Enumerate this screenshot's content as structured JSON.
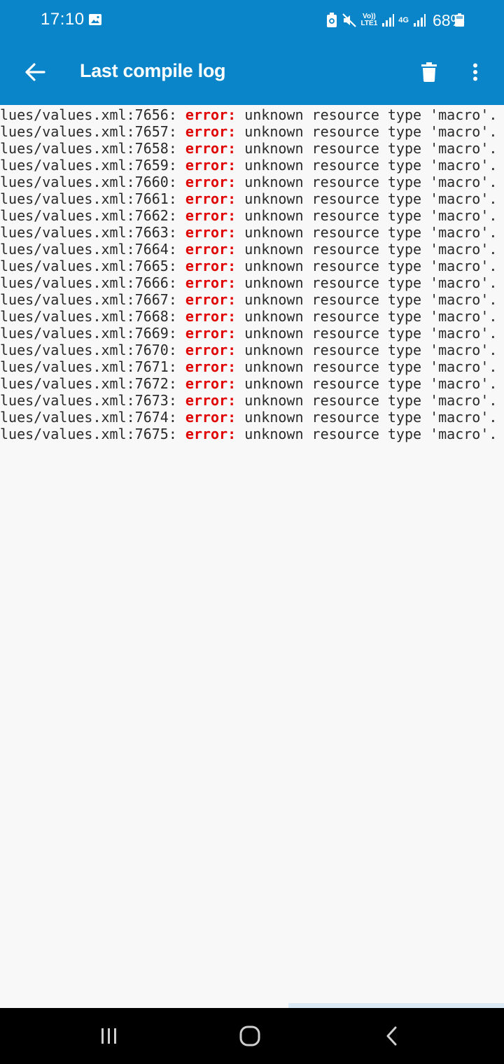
{
  "status_bar": {
    "time": "17:10",
    "network_volte": "Vo))",
    "network_lte": "LTE1",
    "network_4g": "4G",
    "battery_percent": "68%",
    "icons": [
      "gallery-icon",
      "battery-saver-icon",
      "mute-icon",
      "signal-icon",
      "signal-icon",
      "battery-icon"
    ]
  },
  "app_bar": {
    "title": "Last compile log",
    "background_color": "#0a85c9",
    "icons": [
      "back-arrow-icon",
      "trash-icon",
      "more-vert-icon"
    ]
  },
  "log": {
    "error_color": "#e00000",
    "lines": [
      {
        "prefix": "lues/values.xml:7656: ",
        "level": "error:",
        "message": " unknown resource type 'macro'."
      },
      {
        "prefix": "lues/values.xml:7657: ",
        "level": "error:",
        "message": " unknown resource type 'macro'."
      },
      {
        "prefix": "lues/values.xml:7658: ",
        "level": "error:",
        "message": " unknown resource type 'macro'."
      },
      {
        "prefix": "lues/values.xml:7659: ",
        "level": "error:",
        "message": " unknown resource type 'macro'."
      },
      {
        "prefix": "lues/values.xml:7660: ",
        "level": "error:",
        "message": " unknown resource type 'macro'."
      },
      {
        "prefix": "lues/values.xml:7661: ",
        "level": "error:",
        "message": " unknown resource type 'macro'."
      },
      {
        "prefix": "lues/values.xml:7662: ",
        "level": "error:",
        "message": " unknown resource type 'macro'."
      },
      {
        "prefix": "lues/values.xml:7663: ",
        "level": "error:",
        "message": " unknown resource type 'macro'."
      },
      {
        "prefix": "lues/values.xml:7664: ",
        "level": "error:",
        "message": " unknown resource type 'macro'."
      },
      {
        "prefix": "lues/values.xml:7665: ",
        "level": "error:",
        "message": " unknown resource type 'macro'."
      },
      {
        "prefix": "lues/values.xml:7666: ",
        "level": "error:",
        "message": " unknown resource type 'macro'."
      },
      {
        "prefix": "lues/values.xml:7667: ",
        "level": "error:",
        "message": " unknown resource type 'macro'."
      },
      {
        "prefix": "lues/values.xml:7668: ",
        "level": "error:",
        "message": " unknown resource type 'macro'."
      },
      {
        "prefix": "lues/values.xml:7669: ",
        "level": "error:",
        "message": " unknown resource type 'macro'."
      },
      {
        "prefix": "lues/values.xml:7670: ",
        "level": "error:",
        "message": " unknown resource type 'macro'."
      },
      {
        "prefix": "lues/values.xml:7671: ",
        "level": "error:",
        "message": " unknown resource type 'macro'."
      },
      {
        "prefix": "lues/values.xml:7672: ",
        "level": "error:",
        "message": " unknown resource type 'macro'."
      },
      {
        "prefix": "lues/values.xml:7673: ",
        "level": "error:",
        "message": " unknown resource type 'macro'."
      },
      {
        "prefix": "lues/values.xml:7674: ",
        "level": "error:",
        "message": " unknown resource type 'macro'."
      },
      {
        "prefix": "lues/values.xml:7675: ",
        "level": "error:",
        "message": " unknown resource type 'macro'."
      }
    ]
  },
  "nav_bar": {
    "icons": [
      "recents-icon",
      "home-icon",
      "back-icon"
    ]
  }
}
